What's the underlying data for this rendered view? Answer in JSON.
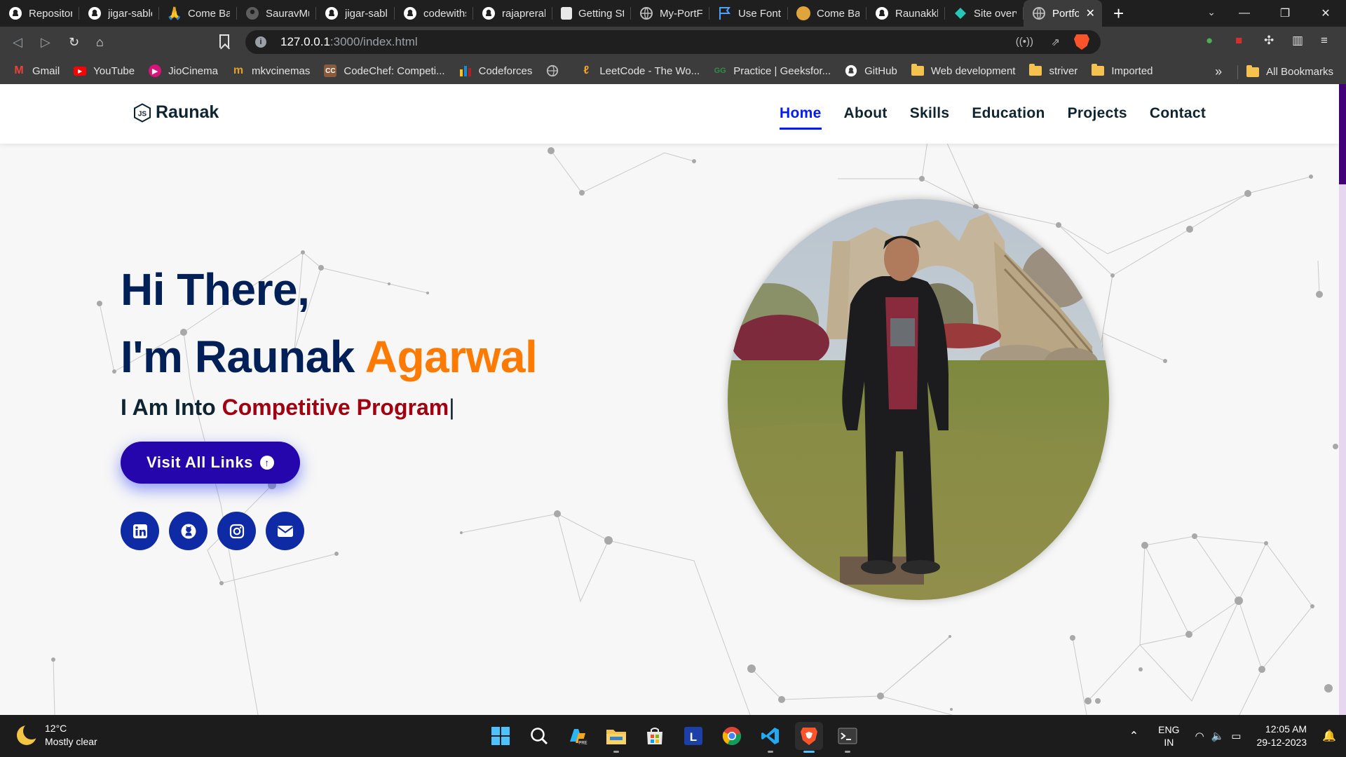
{
  "browser": {
    "tabs": [
      {
        "title": "Repository",
        "icon": "github-icon",
        "icon_color": "#ffffff"
      },
      {
        "title": "jigar-sable",
        "icon": "github-icon",
        "icon_color": "#ffffff"
      },
      {
        "title": "Come Back",
        "icon": "namaste-icon",
        "icon_color": "#f2b233"
      },
      {
        "title": "SauravMu",
        "icon": "github-icon",
        "icon_color": "#5e5e5e"
      },
      {
        "title": "jigar-sable",
        "icon": "github-icon",
        "icon_color": "#ffffff"
      },
      {
        "title": "codewiths",
        "icon": "github-icon",
        "icon_color": "#ffffff"
      },
      {
        "title": "rajaprerak",
        "icon": "github-icon",
        "icon_color": "#ffffff"
      },
      {
        "title": "Getting St",
        "icon": "doc-icon",
        "icon_color": "#e8e8e8"
      },
      {
        "title": "My-PortFo",
        "icon": "globe-icon",
        "icon_color": "#bdbdbd"
      },
      {
        "title": "Use Font A",
        "icon": "flag-icon",
        "icon_color": "#4aa3ff"
      },
      {
        "title": "Come Back",
        "icon": "avatar-icon",
        "icon_color": "#e0a43c"
      },
      {
        "title": "Raunakkk",
        "icon": "github-icon",
        "icon_color": "#ffffff"
      },
      {
        "title": "Site overv",
        "icon": "netlify-icon",
        "icon_color": "#25c7b7"
      },
      {
        "title": "Portfo",
        "icon": "globe-icon",
        "icon_color": "#bdbdbd",
        "active": true
      }
    ],
    "url": {
      "host": "127.0.0.1",
      "path": ":3000/index.html"
    },
    "bookmarks": [
      {
        "label": "Gmail",
        "icon": "gmail-icon",
        "color": "#ea4335"
      },
      {
        "label": "YouTube",
        "icon": "youtube-icon",
        "color": "#ff0000"
      },
      {
        "label": "JioCinema",
        "icon": "jiocinema-icon",
        "color": "#d6147a"
      },
      {
        "label": "mkvcinemas",
        "icon": "mkv-icon",
        "color": "#e2a02b"
      },
      {
        "label": "CodeChef: Competi...",
        "icon": "codechef-icon",
        "color": "#8a5a3c"
      },
      {
        "label": "Codeforces",
        "icon": "codeforces-icon",
        "color": "#1f8acb"
      },
      {
        "label": "",
        "icon": "globe-icon",
        "color": "#bdbdbd"
      },
      {
        "label": "LeetCode - The Wo...",
        "icon": "leetcode-icon",
        "color": "#f0a22b"
      },
      {
        "label": "Practice | Geeksfor...",
        "icon": "gfg-icon",
        "color": "#2f8d46"
      },
      {
        "label": "GitHub",
        "icon": "github-icon",
        "color": "#ffffff"
      },
      {
        "label": "Web development",
        "icon": "folder-icon",
        "color": "#f3c24f"
      },
      {
        "label": "striver",
        "icon": "folder-icon",
        "color": "#f3c24f"
      },
      {
        "label": "Imported",
        "icon": "folder-icon",
        "color": "#f3c24f"
      }
    ],
    "overflow": "»",
    "all_bookmarks": "All Bookmarks"
  },
  "site": {
    "logo": "Raunak",
    "nav": [
      {
        "label": "Home",
        "active": true
      },
      {
        "label": "About"
      },
      {
        "label": "Skills"
      },
      {
        "label": "Education"
      },
      {
        "label": "Projects"
      },
      {
        "label": "Contact"
      }
    ],
    "hero": {
      "line1": "Hi There,",
      "line2_prefix": "I'm Raunak ",
      "line2_accent": "Agarwal",
      "typed_prefix": "I Am Into ",
      "typed_accent": "Competitive Program",
      "typed_cursor": "|"
    },
    "cta": "Visit All Links",
    "socials": [
      "linkedin-icon",
      "github-icon",
      "instagram-icon",
      "envelope-icon"
    ],
    "colors": {
      "primary": "#002057",
      "accent": "#ff7a00",
      "typed": "#a0000f",
      "button": "#2506ad",
      "nav_active": "#011aff"
    }
  },
  "taskbar": {
    "weather": {
      "temp": "12°C",
      "desc": "Mostly clear"
    },
    "lang": {
      "line1": "ENG",
      "line2": "IN"
    },
    "clock": {
      "time": "12:05 AM",
      "date": "29-12-2023"
    }
  }
}
